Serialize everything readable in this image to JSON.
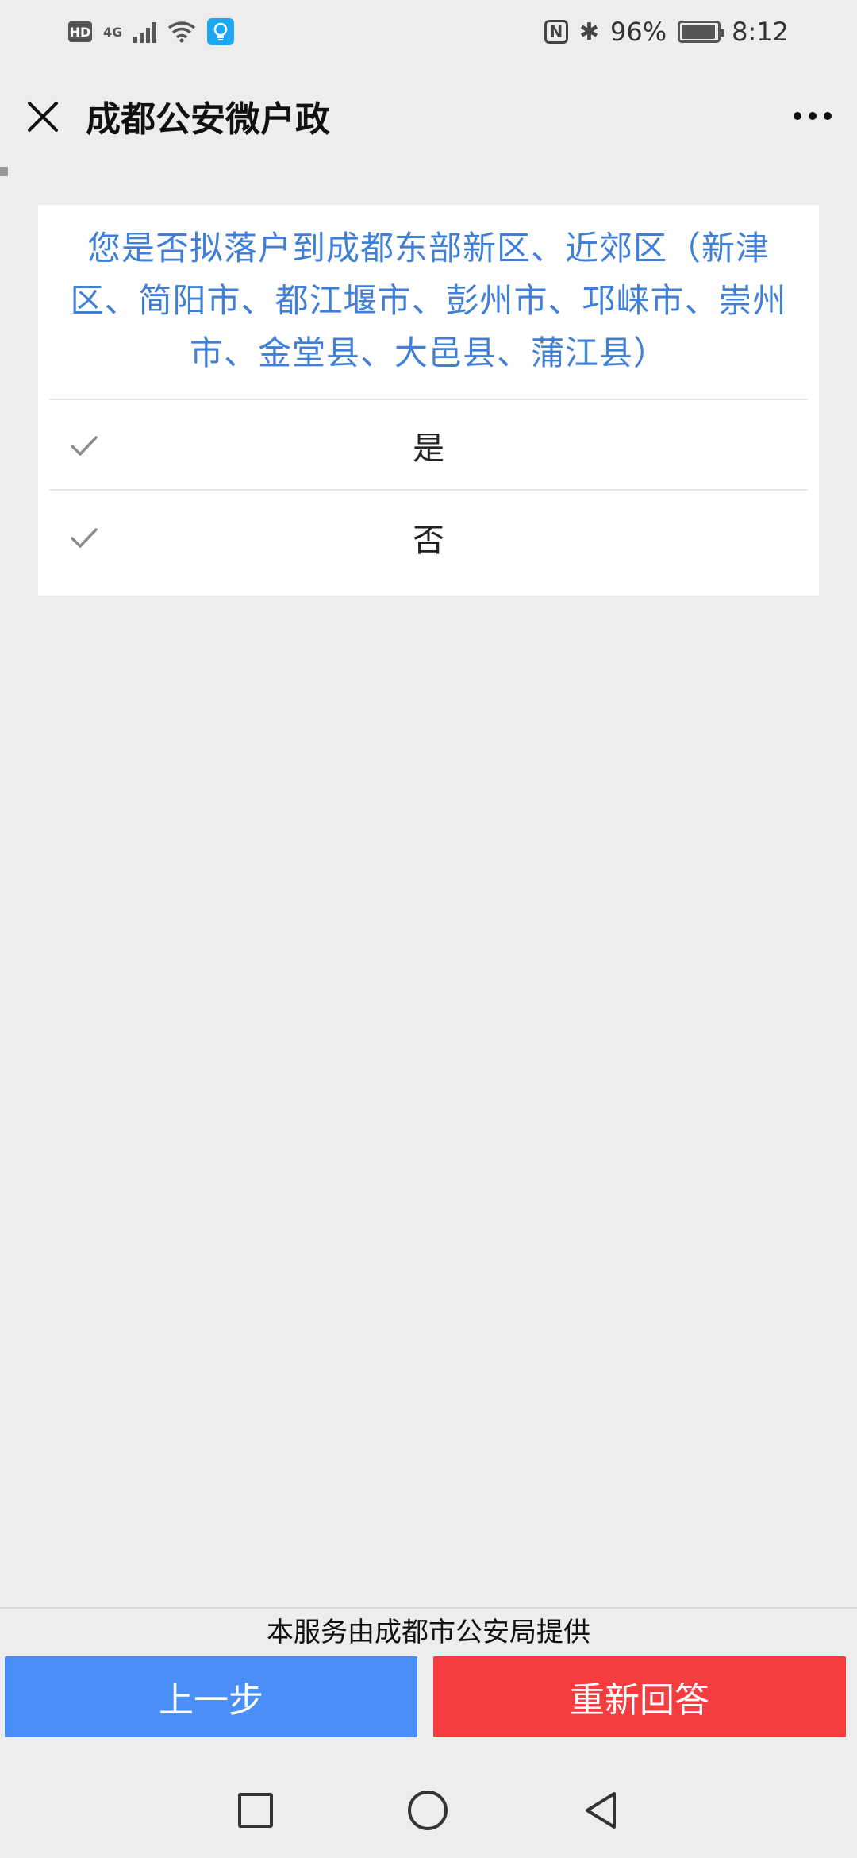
{
  "status_bar": {
    "hd": "HD",
    "network": "4G",
    "battery_percent": "96%",
    "battery_level": 0.96,
    "time": "8:12",
    "icons": [
      "hd-icon",
      "signal-icon",
      "wifi-icon",
      "lightbulb-icon",
      "nfc-icon",
      "bluetooth-icon",
      "battery-icon"
    ]
  },
  "nav": {
    "title": "成都公安微户政",
    "close_icon": "close-icon",
    "more_icon": "more-icon"
  },
  "question": {
    "text": "您是否拟落户到成都东部新区、近郊区（新津区、简阳市、都江堰市、彭州市、邛崃市、崇州市、金堂县、大邑县、蒲江县）",
    "options": [
      {
        "label": "是",
        "icon": "check-icon"
      },
      {
        "label": "否",
        "icon": "check-icon"
      }
    ]
  },
  "footer": {
    "service_note": "本服务由成都市公安局提供",
    "prev_button": "上一步",
    "reset_button": "重新回答"
  },
  "colors": {
    "question_text": "#3f7fd6",
    "prev_button": "#4a8ff7",
    "reset_button": "#f53d40",
    "background": "#ededed"
  }
}
